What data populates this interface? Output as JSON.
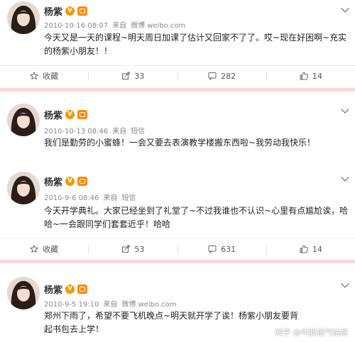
{
  "posts": [
    {
      "name": "杨紫",
      "date": "2010-10-16 08:07",
      "source_prefix": "来自",
      "source": "微博 weibo.com",
      "text": "今天又是一天的课程~明天周日加课了估计又回家不了了。哎~现在好困啊~充实的杨紫小朋友！！",
      "actions": {
        "favorite": "收藏",
        "share": "33",
        "comment": "282",
        "like": "14"
      }
    },
    {
      "name": "杨紫",
      "date": "2010-10-13 08:46",
      "source_prefix": "来自",
      "source": "短信",
      "text": "我们是勤劳的小蜜蜂！一会又要去表演教学楼搬东西啦~我劳动我快乐！"
    },
    {
      "name": "杨紫",
      "date": "2010-9-6 08:46",
      "source_prefix": "来自",
      "source": "短信",
      "text": "今天开学典礼。大家已经坐到了礼堂了~不过我谁也不认识~心里有点尴尬诶，哈哈~一会跟同学们套套近乎！哈哈",
      "actions": {
        "favorite": "收藏",
        "share": "53",
        "comment": "631",
        "like": "14"
      }
    },
    {
      "name": "杨紫",
      "date": "2010-9-5 19:10",
      "source_prefix": "来自",
      "source": "微博 weibo.com",
      "text": "郑州下雨了，希望不要飞机晚点~明天就开学了诶！杨紫小朋友要背起书包去上学！"
    }
  ],
  "watermark": "知乎 @叫我福气姑娘",
  "colors": {
    "divider": "#f7d7dd",
    "badge": "#f39800"
  },
  "icons": [
    "avatar",
    "verified-badge",
    "level-badge",
    "chevron-down-icon",
    "star-icon",
    "share-icon",
    "comment-icon",
    "like-icon"
  ]
}
